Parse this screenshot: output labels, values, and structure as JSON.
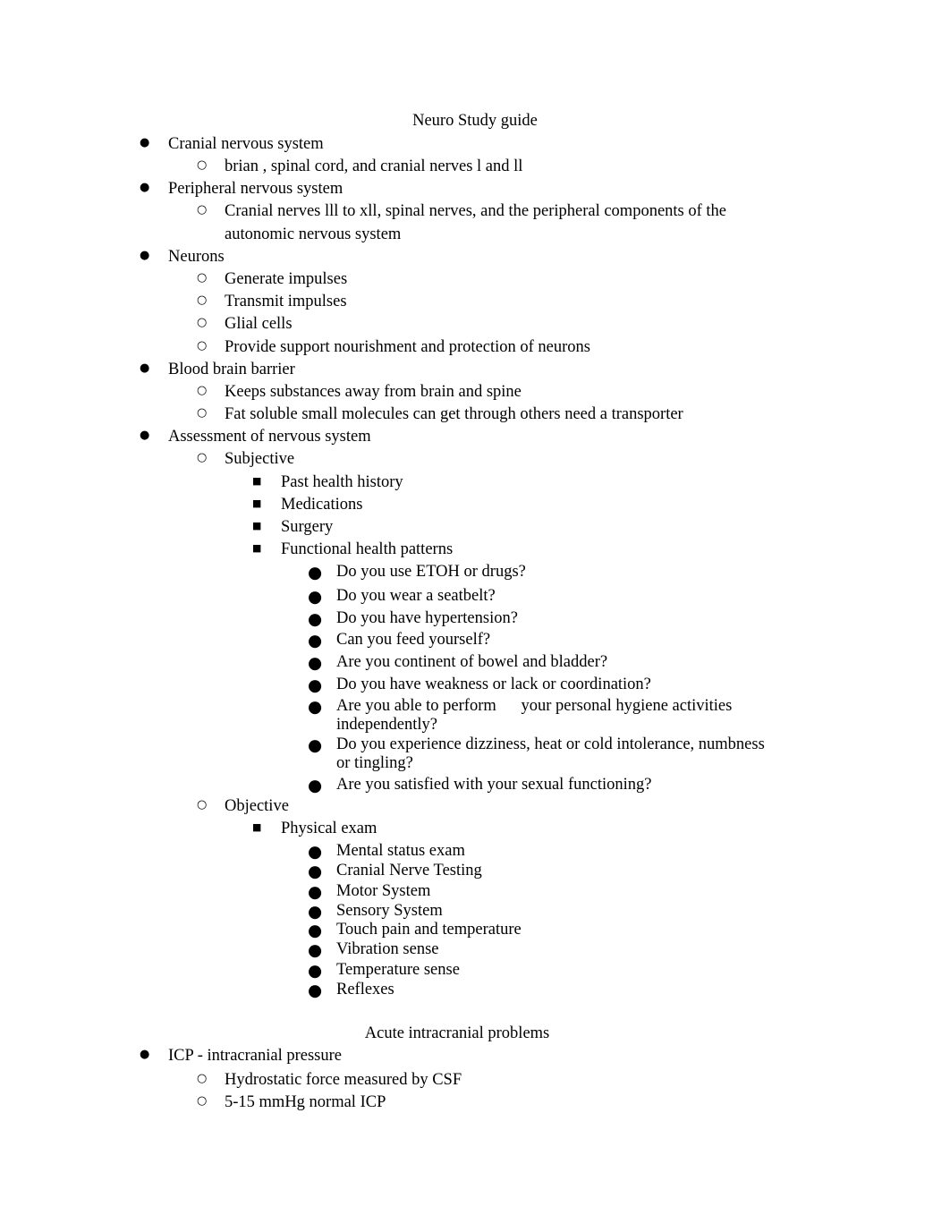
{
  "title": "Neuro Study guide",
  "items": [
    {
      "level": 1,
      "text": "Cranial nervous system"
    },
    {
      "level": 2,
      "text": "brian , spinal cord, and cranial nerves l and ll"
    },
    {
      "level": 1,
      "text": "Peripheral nervous system"
    },
    {
      "level": 2,
      "text": "Cranial nerves lll to xll, spinal nerves, and the peripheral components of the"
    },
    {
      "level": 0,
      "text": "autonomic nervous system"
    },
    {
      "level": 1,
      "text": "Neurons"
    },
    {
      "level": 2,
      "text": "Generate impulses"
    },
    {
      "level": 2,
      "text": "Transmit impulses"
    },
    {
      "level": 2,
      "text": "Glial cells"
    },
    {
      "level": 2,
      "text": "Provide support nourishment and protection of neurons"
    },
    {
      "level": 1,
      "text": "Blood brain barrier"
    },
    {
      "level": 2,
      "text": "Keeps substances away from brain and spine"
    },
    {
      "level": 2,
      "text": "Fat soluble small molecules can get through others need a transporter"
    },
    {
      "level": 1,
      "text": "Assessment of nervous system"
    },
    {
      "level": 2,
      "text": "Subjective"
    },
    {
      "level": 3,
      "text": "Past health history"
    },
    {
      "level": 3,
      "text": "Medications"
    },
    {
      "level": 3,
      "text": "Surgery"
    },
    {
      "level": 3,
      "text": "Functional health patterns"
    },
    {
      "level": 4,
      "text": "Do you use ETOH or drugs?"
    },
    {
      "level": 4,
      "text": "Do you wear a seatbelt?"
    },
    {
      "level": 4,
      "text": "Do you have hypertension?"
    },
    {
      "level": 4,
      "text": "Can you feed yourself?"
    },
    {
      "level": 4,
      "text": "Are you continent of bowel and bladder?"
    },
    {
      "level": 4,
      "text": "Do you have weakness or lack or coordination?"
    },
    {
      "level": 4,
      "text": "Are you able to perform      your personal hygiene activities"
    },
    {
      "level": 0,
      "text": "independently?"
    },
    {
      "level": 4,
      "text": "Do you experience dizziness, heat or cold intolerance, numbness"
    },
    {
      "level": 0,
      "text": "or tingling?"
    },
    {
      "level": 4,
      "text": "Are you satisfied with your sexual functioning?"
    },
    {
      "level": 2,
      "text": "Objective"
    },
    {
      "level": 3,
      "text": "Physical exam"
    },
    {
      "level": 4,
      "text": "Mental status exam"
    },
    {
      "level": 4,
      "text": "Cranial Nerve Testing"
    },
    {
      "level": 4,
      "text": "Motor System"
    },
    {
      "level": 4,
      "text": "Sensory System"
    },
    {
      "level": 4,
      "text": "Touch pain and temperature"
    },
    {
      "level": 4,
      "text": "Vibration sense"
    },
    {
      "level": 4,
      "text": "Temperature sense"
    },
    {
      "level": 4,
      "text": "Reflexes"
    }
  ],
  "section2_title": "Acute intracranial problems",
  "items2": [
    {
      "level": 1,
      "text": "ICP - intracranial pressure"
    },
    {
      "level": 2,
      "text": "Hydrostatic force measured by CSF"
    },
    {
      "level": 2,
      "text": "5-15 mmHg normal ICP"
    }
  ]
}
